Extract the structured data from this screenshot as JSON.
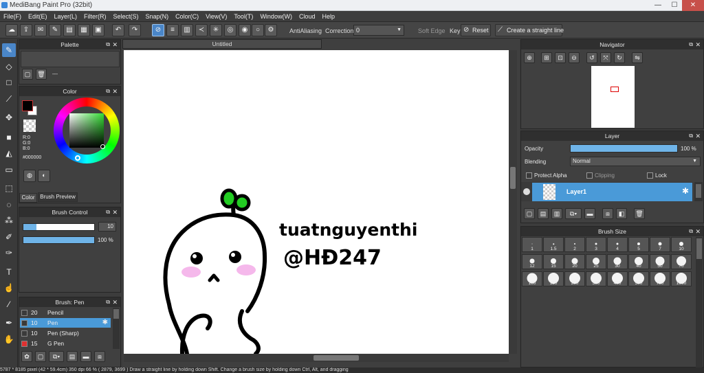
{
  "window": {
    "title": "MediBang Paint Pro (32bit)",
    "min": "—",
    "max": "☐",
    "close": "✕"
  },
  "menu": [
    "File(F)",
    "Edit(E)",
    "Layer(L)",
    "Filter(R)",
    "Select(S)",
    "Snap(N)",
    "Color(C)",
    "View(V)",
    "Tool(T)",
    "Window(W)",
    "Cloud",
    "Help"
  ],
  "toolbar": {
    "antialiasing": "AntiAliasing",
    "correction": "Correction",
    "correction_value": "0",
    "soft_edge": "Soft Edge",
    "key": "Key",
    "reset": "Reset",
    "straight_line": "Create a straight line"
  },
  "palette": {
    "title": "Palette",
    "name": "---"
  },
  "color": {
    "title": "Color",
    "r": "R:0",
    "g": "G:0",
    "b": "B:0",
    "hex": "#000000",
    "tab_color": "Color",
    "tab_preview": "Brush Preview"
  },
  "brush_control": {
    "title": "Brush Control",
    "size": "10",
    "opacity": "100 %",
    "size_fill": 0.1,
    "opacity_fill": 1.0
  },
  "brush_list": {
    "title": "Brush: Pen",
    "items": [
      {
        "size": "20",
        "name": "Pencil",
        "color": "#3a3a3a"
      },
      {
        "size": "10",
        "name": "Pen",
        "color": "#3a3a3a"
      },
      {
        "size": "10",
        "name": "Pen (Sharp)",
        "color": "#3a3a3a"
      },
      {
        "size": "15",
        "name": "G Pen",
        "color": "#e03030"
      }
    ],
    "selected_index": 1
  },
  "document": {
    "tab": "Untitled",
    "drawing_text_1": "tuatnguyenthi",
    "drawing_text_2": "@HĐ247"
  },
  "navigator": {
    "title": "Navigator"
  },
  "layer": {
    "title": "Layer",
    "opacity_label": "Opacity",
    "opacity_value": "100 %",
    "opacity_fill": 1.0,
    "blending_label": "Blending",
    "blending_value": "Normal",
    "protect_alpha": "Protect Alpha",
    "clipping": "Clipping",
    "lock": "Lock",
    "layer_name": "Layer1"
  },
  "brush_size": {
    "title": "Brush Size",
    "sizes": [
      "1",
      "1.5",
      "2",
      "3",
      "4",
      "5",
      "7",
      "10",
      "12",
      "15",
      "20",
      "25",
      "30",
      "40",
      "50",
      "70",
      "100",
      "150",
      "200",
      "300",
      "400",
      "500",
      "700",
      "1000"
    ]
  },
  "status": {
    "text": "5787 * 8185 pixel   (42 * 59.4cm)   350 dpi   66 %   ( 2879, 3699 )   Draw a straight line by holding down Shift. Change a brush size by holding down Ctrl, Alt, and dragging"
  },
  "colors": {
    "accent": "#4a86c8",
    "layer_selected": "#4a9ad8",
    "sprout": "#22cc22",
    "blush": "#ee88dd"
  }
}
